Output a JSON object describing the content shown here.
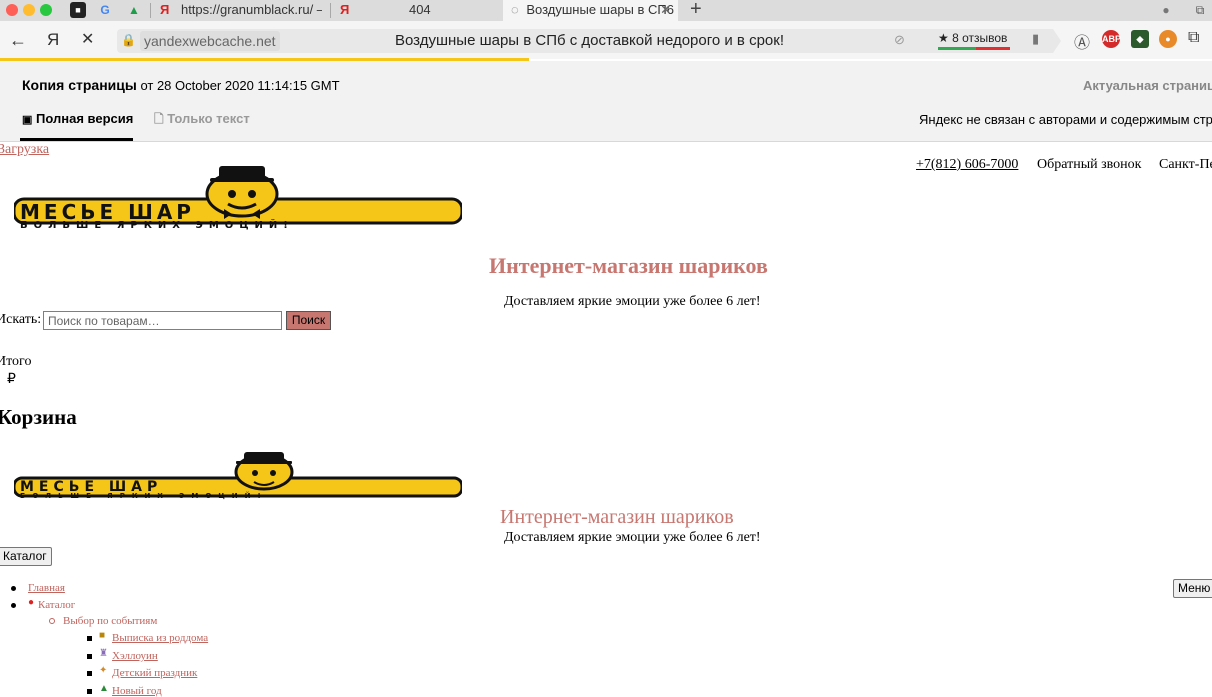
{
  "browser": {
    "tabs": [
      {
        "label": "https://granumblack.ru/ —"
      },
      {
        "label": "404"
      },
      {
        "label": "Воздушные шары в СП6"
      }
    ],
    "address_domain": "yandexwebcache.net",
    "page_title": "Воздушные шары в СПб с доставкой недорого и в срок!",
    "reviews": "★ 8 отзывов",
    "extensions": [
      "ABP"
    ]
  },
  "cache": {
    "title_bold": "Копия страницы",
    "title_rest": " от 28 October 2020 11:14:15 GMT",
    "current_link": "Актуальная страница",
    "tab_full": "Полная версия",
    "tab_text": "Только текст",
    "note": "Яндекс не связан с авторами и содержимым стран"
  },
  "page": {
    "loading": "Загрузка",
    "phone": "+7(812) 606-7000 ",
    "callback": "Обратный звонок",
    "city": "Санкт-Пе",
    "logo_text": "МЕСЬЕ ШАР",
    "logo_tagline": "БОЛЬШЕ ЯРКИХ ЭМОЦИЙ!",
    "shop_title": "Интернет-магазин шариков",
    "shop_subtitle": "Доставляем яркие эмоции уже более 6 лет!",
    "search_label": "Искать:",
    "search_placeholder": "Поиск по товарам…",
    "search_button": "Поиск",
    "total_label": "Итого",
    "currency": "₽",
    "cart_heading": "Корзина",
    "shop_title_2": "Интернет-магазин шариков",
    "shop_subtitle_2": "Доставляем яркие эмоции уже более 6 лет!",
    "catalog_button": "Каталог",
    "menu_button": "Меню",
    "menu": {
      "home": "Главная",
      "catalog": "Каталог",
      "by_event": "Выбор по событиям",
      "events": [
        "Выписка из роддома",
        "Хэллоуин",
        "Детский праздник",
        "Новый год"
      ]
    }
  }
}
